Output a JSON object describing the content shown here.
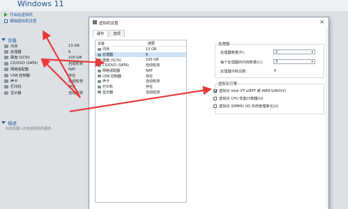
{
  "window": {
    "vm_name": "Windows 11"
  },
  "actions": [
    {
      "label": "开启此虚拟机"
    },
    {
      "label": "编辑虚拟机设置"
    }
  ],
  "devices_section": {
    "title": "设备"
  },
  "devices": [
    {
      "name": "内存",
      "value": "13 GB"
    },
    {
      "name": "处理器",
      "value": "6"
    },
    {
      "name": "硬盘 (SCSI)",
      "value": "100 GB"
    },
    {
      "name": "CD/DVD (SATA)",
      "value": "自动检测"
    },
    {
      "name": "网络适配器",
      "value": "NAT"
    },
    {
      "name": "USB 控制器",
      "value": "存在"
    },
    {
      "name": "声卡",
      "value": "自动检测"
    },
    {
      "name": "打印机",
      "value": "存在"
    },
    {
      "name": "显示器",
      "value": "自动检测"
    }
  ],
  "description_section": {
    "title": "描述",
    "placeholder": "在此处键入对该虚拟机的描述。"
  },
  "dialog": {
    "title": "虚拟机设置",
    "close": "×",
    "tabs": [
      "硬件",
      "选项"
    ],
    "table_headers": {
      "device": "设备",
      "summary": "摘要"
    },
    "table_rows": [
      {
        "name": "内存",
        "value": "13 GB"
      },
      {
        "name": "处理器",
        "value": "6"
      },
      {
        "name": "硬盘 (SCSI)",
        "value": "100 GB"
      },
      {
        "name": "CD/DVD (SATA)",
        "value": "自动检测"
      },
      {
        "name": "网络适配器",
        "value": "NAT"
      },
      {
        "name": "USB 控制器",
        "value": "存在"
      },
      {
        "name": "声卡",
        "value": "自动检测"
      },
      {
        "name": "打印机",
        "value": "存在"
      },
      {
        "name": "显示器",
        "value": "自动检测"
      }
    ],
    "processor_group": {
      "title": "处理器",
      "count_label": "处理器数量(P):",
      "count_value": "2",
      "cores_label": "每个处理器的内核数量(C):",
      "cores_value": "3",
      "total_label": "处理器内核总数:",
      "total_value": "6"
    },
    "virtualization_group": {
      "title": "虚拟化引擎",
      "options": [
        {
          "label": "虚拟化 Intel VT-x/EPT 或 AMD-V/RVI(V)",
          "checked": true
        },
        {
          "label": "虚拟化 CPU 性能计数器(U)",
          "checked": false
        },
        {
          "label": "虚拟化 IOMMU (IO 内存管理单元)(I)",
          "checked": false
        }
      ]
    }
  },
  "colors": {
    "arrow": "#e8383a",
    "accent": "#2a5f9e",
    "selection": "#cfe3f7"
  }
}
